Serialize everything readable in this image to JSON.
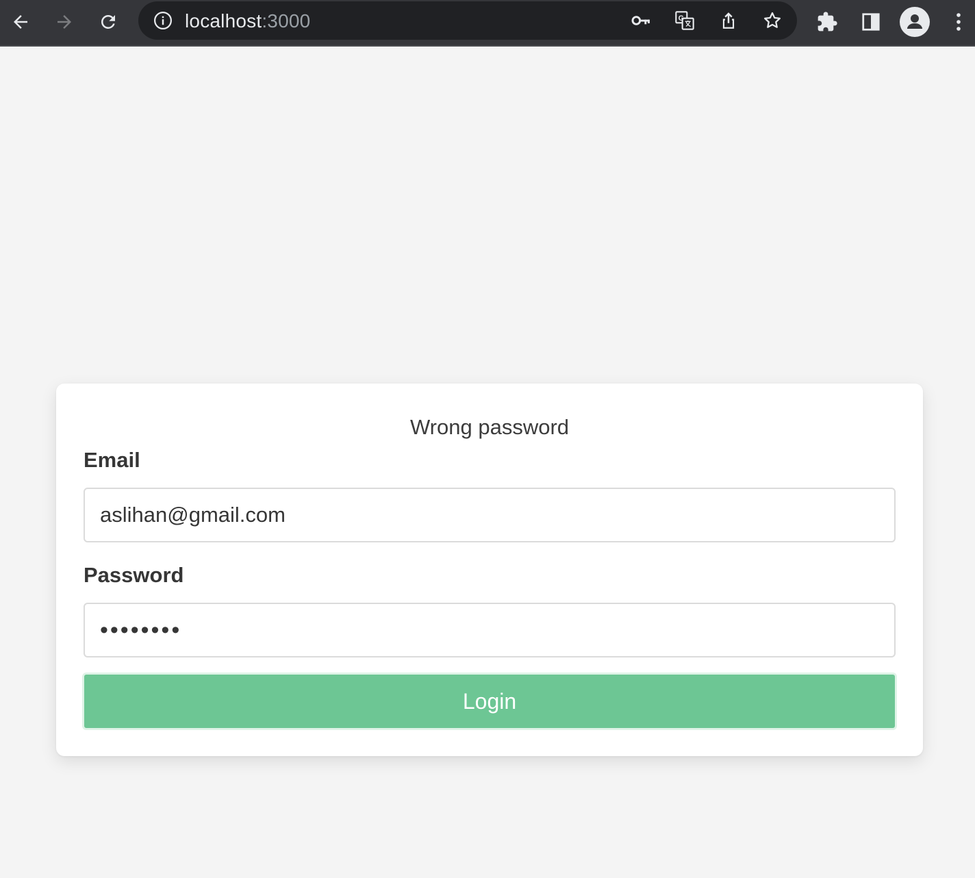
{
  "browser": {
    "url_host": "localhost",
    "url_port": ":3000",
    "icons": {
      "back": "back-arrow-icon",
      "forward": "forward-arrow-icon",
      "reload": "reload-icon",
      "site_info": "info-icon",
      "password": "key-icon",
      "translate": "translate-icon",
      "share": "share-icon",
      "bookmark": "star-icon",
      "extensions": "puzzle-icon",
      "side_panel": "side-panel-icon",
      "profile": "profile-icon",
      "menu": "kebab-menu-icon"
    },
    "colors": {
      "toolbar": "#35363a",
      "omnibox": "#202124",
      "icon": "#e8eaed",
      "icon_disabled": "#7c7d80"
    }
  },
  "login_form": {
    "error_message": "Wrong password",
    "email_label": "Email",
    "email_value": "aslihan@gmail.com",
    "password_label": "Password",
    "password_value": "••••••••",
    "submit_label": "Login",
    "colors": {
      "page_background": "#f4f4f4",
      "button": "#6dc694",
      "text": "#363636"
    }
  }
}
